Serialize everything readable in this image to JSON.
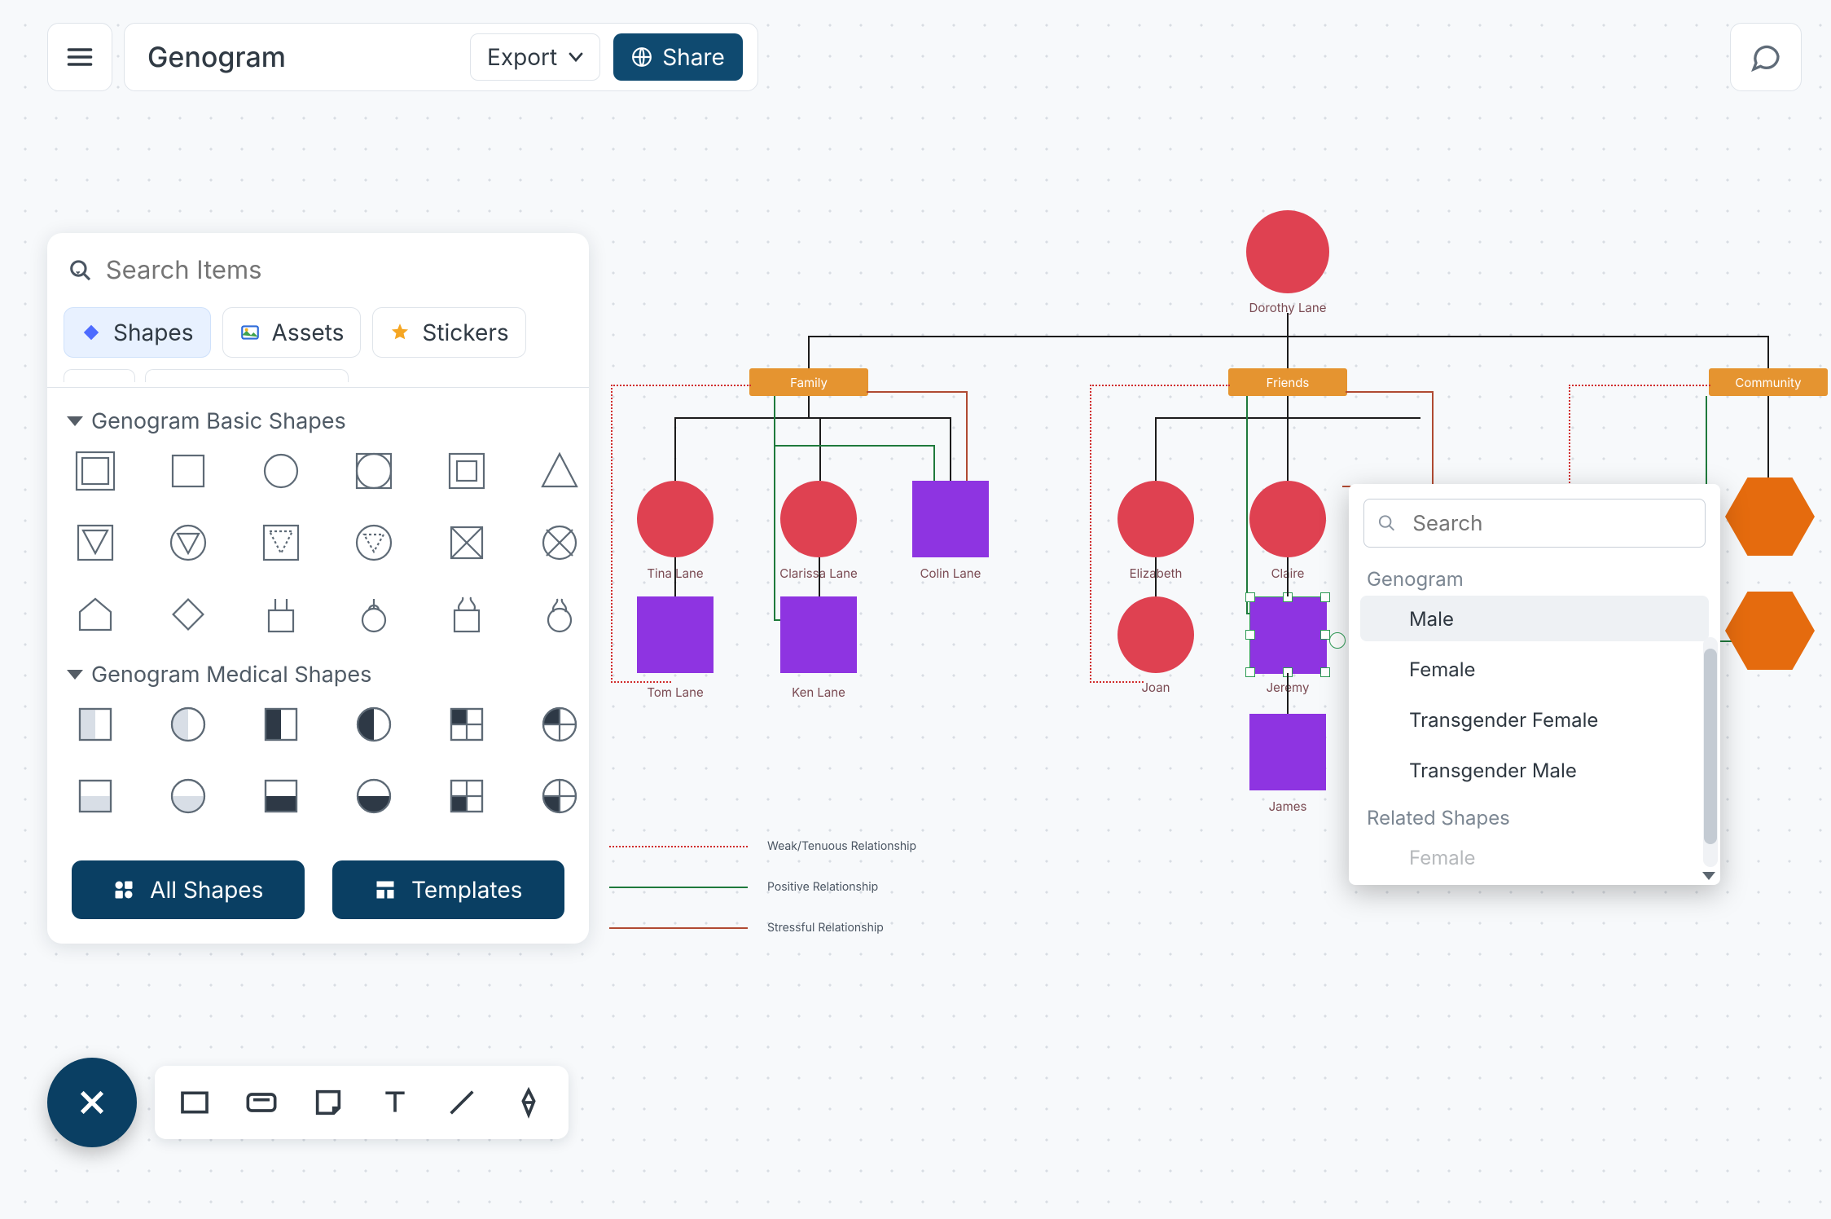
{
  "header": {
    "title": "Genogram",
    "export_label": "Export",
    "share_label": "Share"
  },
  "panel": {
    "search_placeholder": "Search Items",
    "tabs": {
      "shapes": "Shapes",
      "assets": "Assets",
      "stickers": "Stickers"
    },
    "section_basic": "Genogram Basic Shapes",
    "section_medical": "Genogram Medical Shapes",
    "all_shapes": "All Shapes",
    "templates": "Templates"
  },
  "popup": {
    "search_placeholder": "Search",
    "group1": "Genogram",
    "items": [
      "Male",
      "Female",
      "Transgender Female",
      "Transgender Male"
    ],
    "group2": "Related Shapes",
    "peek_item": "Female"
  },
  "legend": {
    "weak": "Weak/Tenuous Relationship",
    "positive": "Positive Relationship",
    "stressful": "Stressful Relationship"
  },
  "nodes": {
    "root": "Dorothy Lane",
    "family": "Family",
    "friends": "Friends",
    "community": "Community",
    "tina": "Tina Lane",
    "clarissa": "Clarissa Lane",
    "colin": "Colin Lane",
    "tom": "Tom Lane",
    "ken": "Ken Lane",
    "elizabeth": "Elizabeth",
    "claire": "Claire",
    "joan": "Joan",
    "jeremy": "Jeremy",
    "james": "James"
  },
  "chart_data": {
    "type": "tree",
    "root": {
      "label": "Dorothy Lane",
      "shape": "circle",
      "color": "red"
    },
    "groups": [
      {
        "label": "Family",
        "color": "orange",
        "children": [
          {
            "label": "Tina Lane",
            "shape": "circle",
            "color": "red",
            "children": [
              {
                "label": "Tom Lane",
                "shape": "square",
                "color": "purple"
              }
            ]
          },
          {
            "label": "Clarissa Lane",
            "shape": "circle",
            "color": "red",
            "children": [
              {
                "label": "Ken Lane",
                "shape": "square",
                "color": "purple"
              }
            ]
          },
          {
            "label": "Colin Lane",
            "shape": "square",
            "color": "purple"
          }
        ]
      },
      {
        "label": "Friends",
        "color": "orange",
        "children": [
          {
            "label": "Elizabeth",
            "shape": "circle",
            "color": "red",
            "children": [
              {
                "label": "Joan",
                "shape": "circle",
                "color": "red"
              }
            ]
          },
          {
            "label": "Claire",
            "shape": "circle",
            "color": "red",
            "children": [
              {
                "label": "Jeremy",
                "shape": "square",
                "color": "purple",
                "selected": true,
                "children": [
                  {
                    "label": "James",
                    "shape": "square",
                    "color": "purple"
                  }
                ]
              }
            ]
          }
        ]
      },
      {
        "label": "Community",
        "color": "orange",
        "children": [
          {
            "label": "",
            "shape": "hexagon",
            "color": "orange-dark"
          },
          {
            "label": "",
            "shape": "hexagon",
            "color": "orange-dark"
          }
        ]
      }
    ],
    "edge_styles": {
      "black-solid": "structural",
      "red-dotted": "Weak/Tenuous Relationship",
      "green-solid": "Positive Relationship",
      "brick-solid": "Stressful Relationship"
    }
  }
}
